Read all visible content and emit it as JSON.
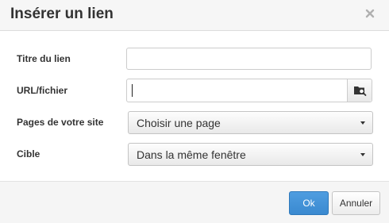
{
  "dialog": {
    "title": "Insérer un lien"
  },
  "form": {
    "link_title": {
      "label": "Titre du lien",
      "value": ""
    },
    "url": {
      "label": "URL/fichier",
      "value": ""
    },
    "pages": {
      "label": "Pages de votre site",
      "selected": "Choisir une page"
    },
    "target": {
      "label": "Cible",
      "selected": "Dans la même fenêtre"
    }
  },
  "footer": {
    "ok_label": "Ok",
    "cancel_label": "Annuler"
  },
  "colors": {
    "primary": "#3a89d0",
    "header_bg": "#f6f6f6",
    "footer_bg": "#f5f5f5"
  },
  "icons": {
    "close": "close-icon",
    "browse": "folder-search-icon",
    "dropdown": "caret-down-icon"
  }
}
